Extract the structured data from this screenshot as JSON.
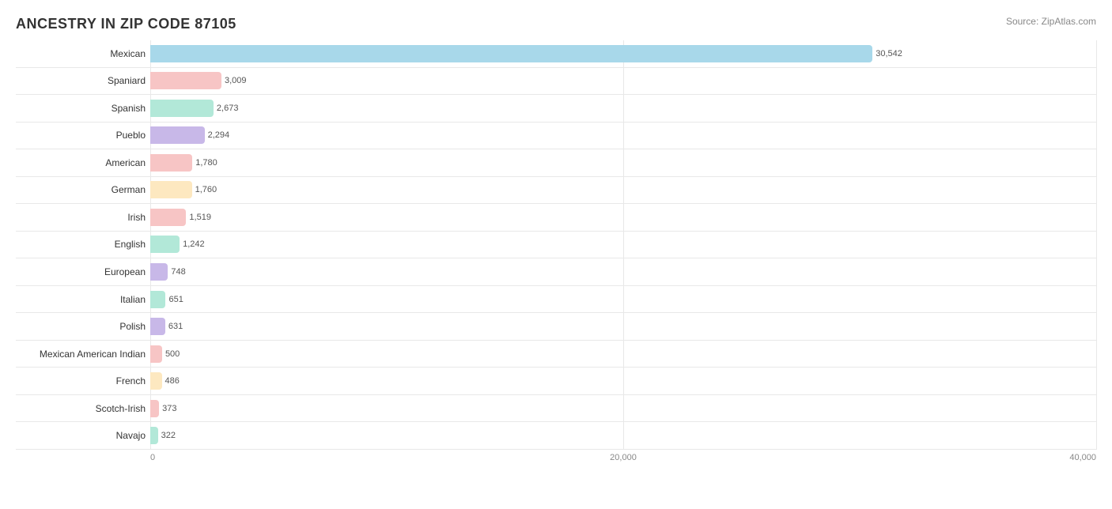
{
  "title": "ANCESTRY IN ZIP CODE 87105",
  "source": "Source: ZipAtlas.com",
  "maxValue": 40000,
  "gridLines": [
    0,
    20000,
    40000
  ],
  "xAxisLabels": [
    "0",
    "20,000",
    "40,000"
  ],
  "bars": [
    {
      "label": "Mexican",
      "value": 30542,
      "displayValue": "30,542",
      "color": "#a8d8ea"
    },
    {
      "label": "Spaniard",
      "value": 3009,
      "displayValue": "3,009",
      "color": "#f7c5c5"
    },
    {
      "label": "Spanish",
      "value": 2673,
      "displayValue": "2,673",
      "color": "#b2e8d8"
    },
    {
      "label": "Pueblo",
      "value": 2294,
      "displayValue": "2,294",
      "color": "#c8b8e8"
    },
    {
      "label": "American",
      "value": 1780,
      "displayValue": "1,780",
      "color": "#f7c5c5"
    },
    {
      "label": "German",
      "value": 1760,
      "displayValue": "1,760",
      "color": "#fde8c0"
    },
    {
      "label": "Irish",
      "value": 1519,
      "displayValue": "1,519",
      "color": "#f7c5c5"
    },
    {
      "label": "English",
      "value": 1242,
      "displayValue": "1,242",
      "color": "#b2e8d8"
    },
    {
      "label": "European",
      "value": 748,
      "displayValue": "748",
      "color": "#c8b8e8"
    },
    {
      "label": "Italian",
      "value": 651,
      "displayValue": "651",
      "color": "#b2e8d8"
    },
    {
      "label": "Polish",
      "value": 631,
      "displayValue": "631",
      "color": "#c8b8e8"
    },
    {
      "label": "Mexican American Indian",
      "value": 500,
      "displayValue": "500",
      "color": "#f7c5c5"
    },
    {
      "label": "French",
      "value": 486,
      "displayValue": "486",
      "color": "#fde8c0"
    },
    {
      "label": "Scotch-Irish",
      "value": 373,
      "displayValue": "373",
      "color": "#f7c5c5"
    },
    {
      "label": "Navajo",
      "value": 322,
      "displayValue": "322",
      "color": "#b2e8d8"
    }
  ]
}
